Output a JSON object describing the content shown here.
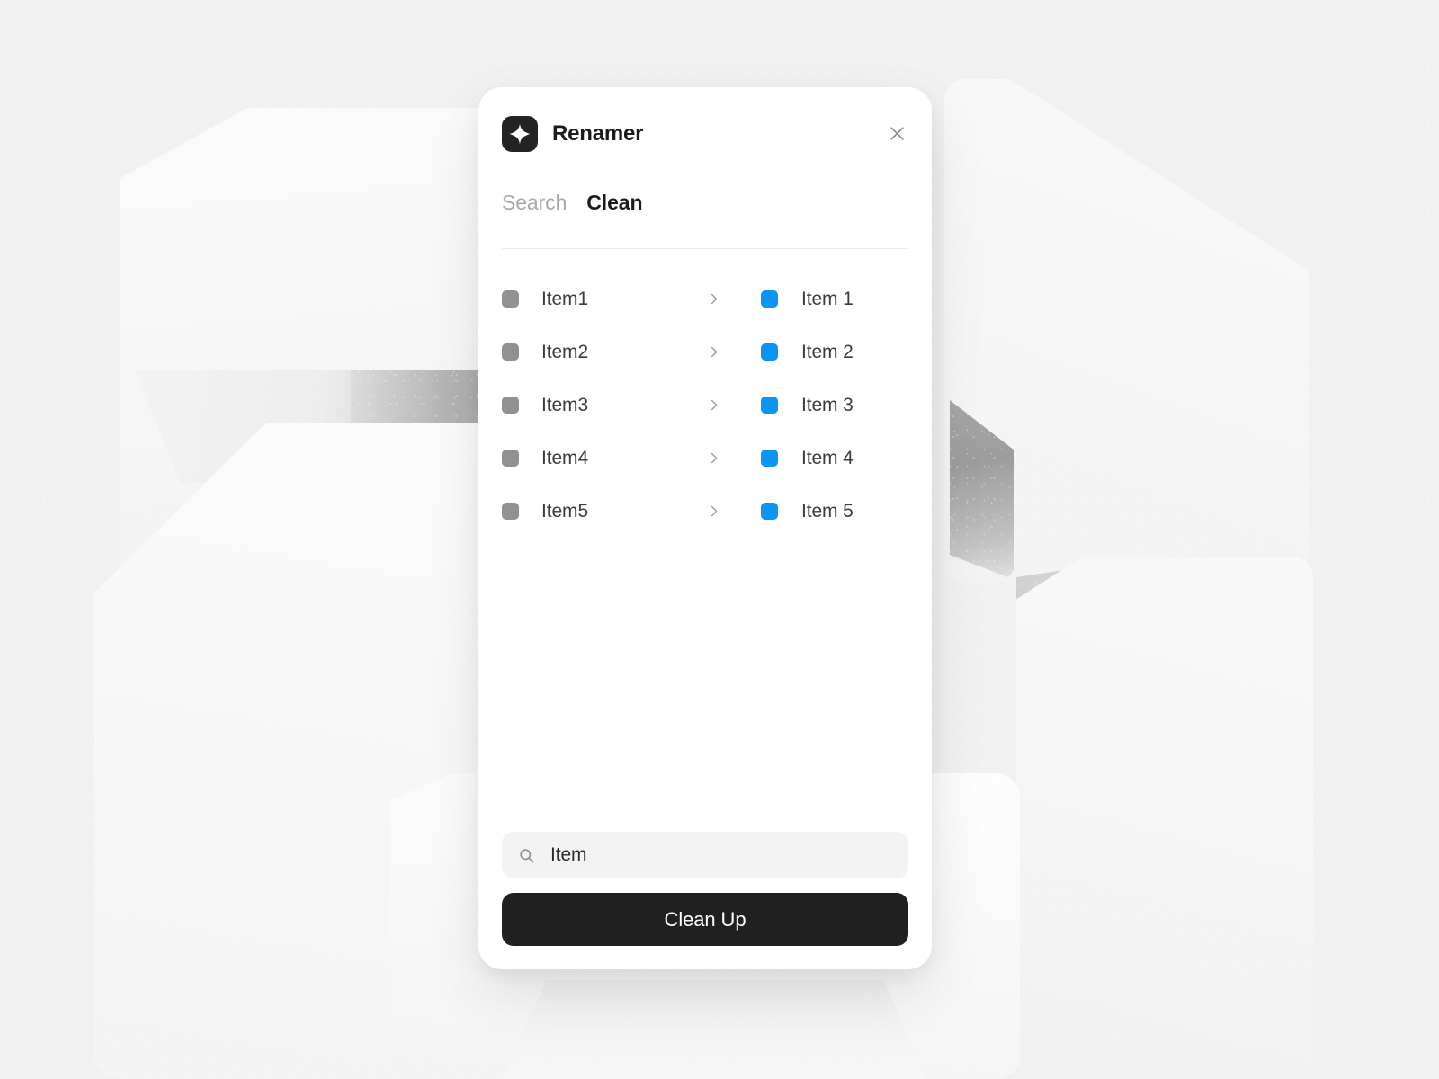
{
  "window": {
    "title": "Renamer",
    "app_icon": "sparkle-icon",
    "close_icon": "close-icon",
    "brand_color": "#232323",
    "accent_color": "#0a95f4",
    "card_background": "#ffffff",
    "page_background": "#f0f0f0"
  },
  "tabs": [
    {
      "label": "Search",
      "active": false
    },
    {
      "label": "Clean",
      "active": true
    }
  ],
  "list": {
    "arrow_icon": "chevron-right-icon",
    "rows": [
      {
        "source_swatch": "#919191",
        "source": "Item1",
        "arrow": "›",
        "target_swatch": "#0a95f4",
        "target": "Item 1"
      },
      {
        "source_swatch": "#919191",
        "source": "Item2",
        "arrow": "›",
        "target_swatch": "#0a95f4",
        "target": "Item 2"
      },
      {
        "source_swatch": "#919191",
        "source": "Item3",
        "arrow": "›",
        "target_swatch": "#0a95f4",
        "target": "Item 3"
      },
      {
        "source_swatch": "#919191",
        "source": "Item4",
        "arrow": "›",
        "target_swatch": "#0a95f4",
        "target": "Item 4"
      },
      {
        "source_swatch": "#919191",
        "source": "Item5",
        "arrow": "›",
        "target_swatch": "#0a95f4",
        "target": "Item 5"
      }
    ]
  },
  "search": {
    "icon": "search-icon",
    "value": "Item",
    "placeholder": "Item"
  },
  "action": {
    "label": "Clean Up"
  }
}
